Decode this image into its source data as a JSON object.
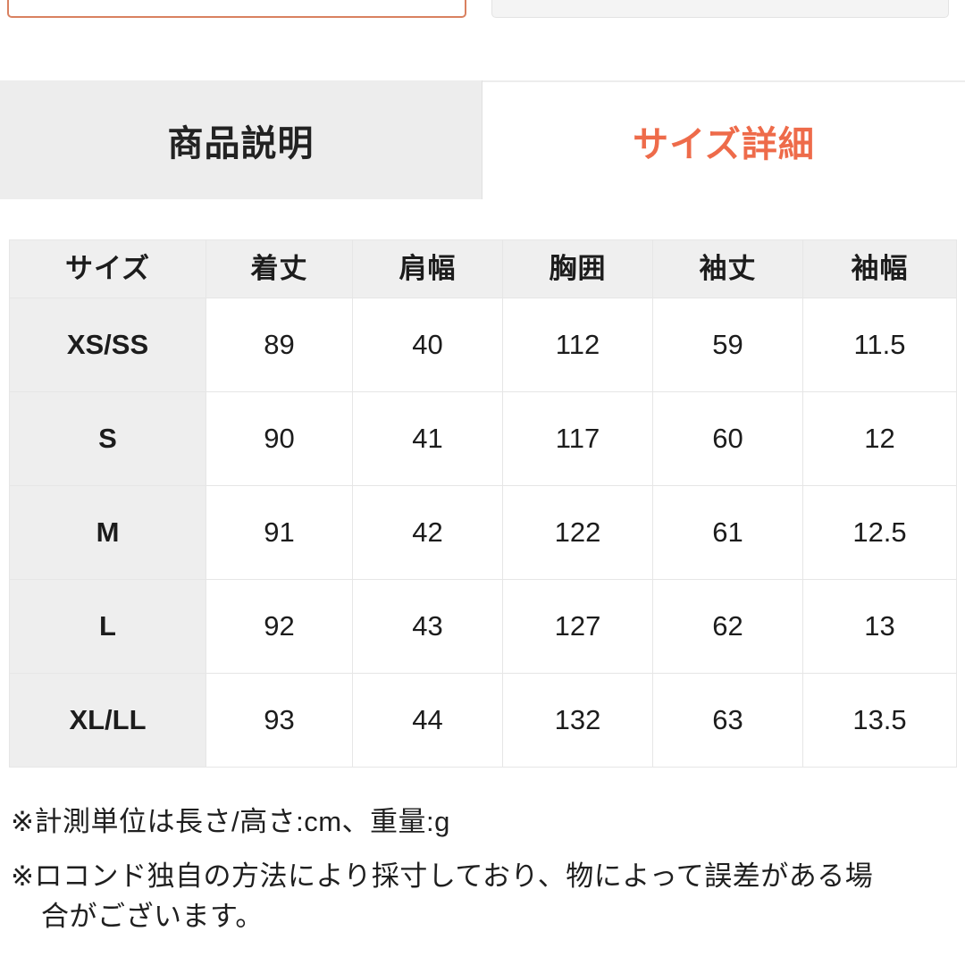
{
  "top_partial": {
    "left_box_state": "selected",
    "right_box_state": "default",
    "accent_color": "#d98160",
    "neutral_color": "#e3e3e3"
  },
  "tabs": [
    {
      "label": "商品説明",
      "active": false
    },
    {
      "label": "サイズ詳細",
      "active": true
    }
  ],
  "active_tab_color": "#ee6b4a",
  "size_table": {
    "headers": [
      "サイズ",
      "着丈",
      "肩幅",
      "胸囲",
      "袖丈",
      "袖幅"
    ],
    "rows": [
      {
        "size": "XS/SS",
        "values": [
          "89",
          "40",
          "112",
          "59",
          "11.5"
        ]
      },
      {
        "size": "S",
        "values": [
          "90",
          "41",
          "117",
          "60",
          "12"
        ]
      },
      {
        "size": "M",
        "values": [
          "91",
          "42",
          "122",
          "61",
          "12.5"
        ]
      },
      {
        "size": "L",
        "values": [
          "92",
          "43",
          "127",
          "62",
          "13"
        ]
      },
      {
        "size": "XL/LL",
        "values": [
          "93",
          "44",
          "132",
          "63",
          "13.5"
        ]
      }
    ]
  },
  "notes": [
    {
      "line1": "※計測単位は長さ/高さ:cm、重量:g",
      "line2": ""
    },
    {
      "line1": "※ロコンド独自の方法により採寸しており、物によって誤差がある場",
      "line2": "合がございます。"
    }
  ]
}
